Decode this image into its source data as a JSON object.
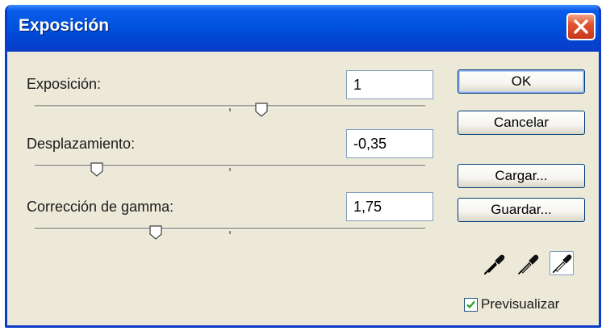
{
  "window": {
    "title": "Exposición"
  },
  "controls": [
    {
      "label": "Exposición:",
      "value": "1",
      "slider_level": 0.58
    },
    {
      "label": "Desplazamiento:",
      "value": "-0,35",
      "slider_level": 0.16
    },
    {
      "label": "Corrección de gamma:",
      "value": "1,75",
      "slider_level": 0.31
    }
  ],
  "buttons": {
    "ok": "OK",
    "cancel": "Cancelar",
    "load": "Cargar...",
    "save": "Guardar..."
  },
  "eyedroppers": {
    "items": [
      "black-point-eyedropper-icon",
      "gray-point-eyedropper-icon",
      "white-point-eyedropper-icon"
    ],
    "selected_index": 2
  },
  "preview": {
    "label": "Previsualizar",
    "checked": true
  },
  "colors": {
    "titlebar": "#0052e0",
    "dialog_bg": "#ece9d8",
    "close_button": "#e2532f"
  }
}
